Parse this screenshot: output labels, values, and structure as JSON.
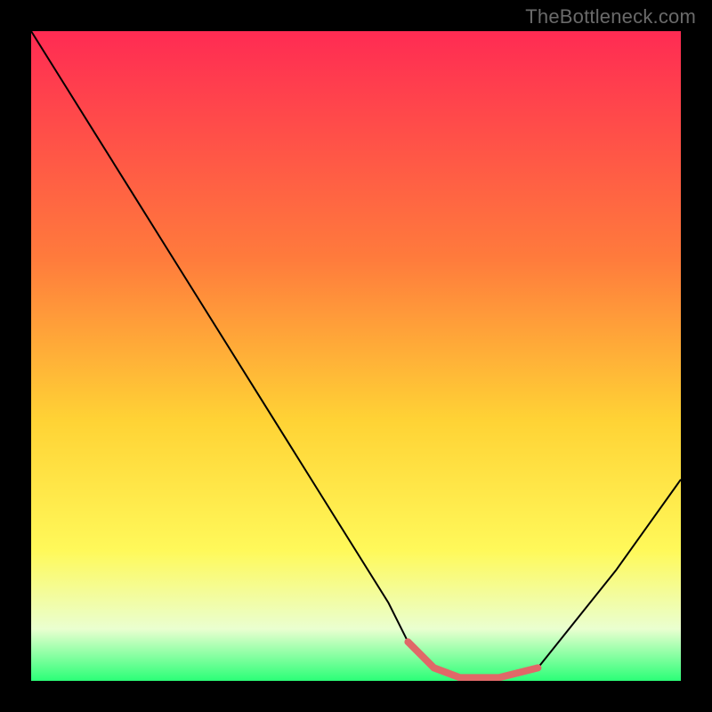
{
  "watermark": "TheBottleneck.com",
  "chart_data": {
    "type": "line",
    "title": "",
    "xlabel": "",
    "ylabel": "",
    "xlim": [
      0,
      100
    ],
    "ylim": [
      0,
      100
    ],
    "gradient": {
      "top_color": "#ff2b53",
      "mid_color": "#ffe635",
      "bottom_color": "#2bff77"
    },
    "series": [
      {
        "name": "bottleneck-curve",
        "x": [
          0,
          5,
          10,
          15,
          20,
          25,
          30,
          35,
          40,
          45,
          50,
          55,
          58,
          62,
          66,
          72,
          78,
          82,
          86,
          90,
          95,
          100
        ],
        "values": [
          100,
          92,
          84,
          76,
          68,
          60,
          52,
          44,
          36,
          28,
          20,
          12,
          6,
          2,
          0.5,
          0.5,
          2,
          7,
          12,
          17,
          24,
          31
        ]
      }
    ],
    "highlight_segment": {
      "name": "optimal-range",
      "color": "#e06868",
      "x": [
        58,
        62,
        66,
        72,
        78
      ],
      "values": [
        6,
        2,
        0.5,
        0.5,
        2
      ]
    }
  }
}
